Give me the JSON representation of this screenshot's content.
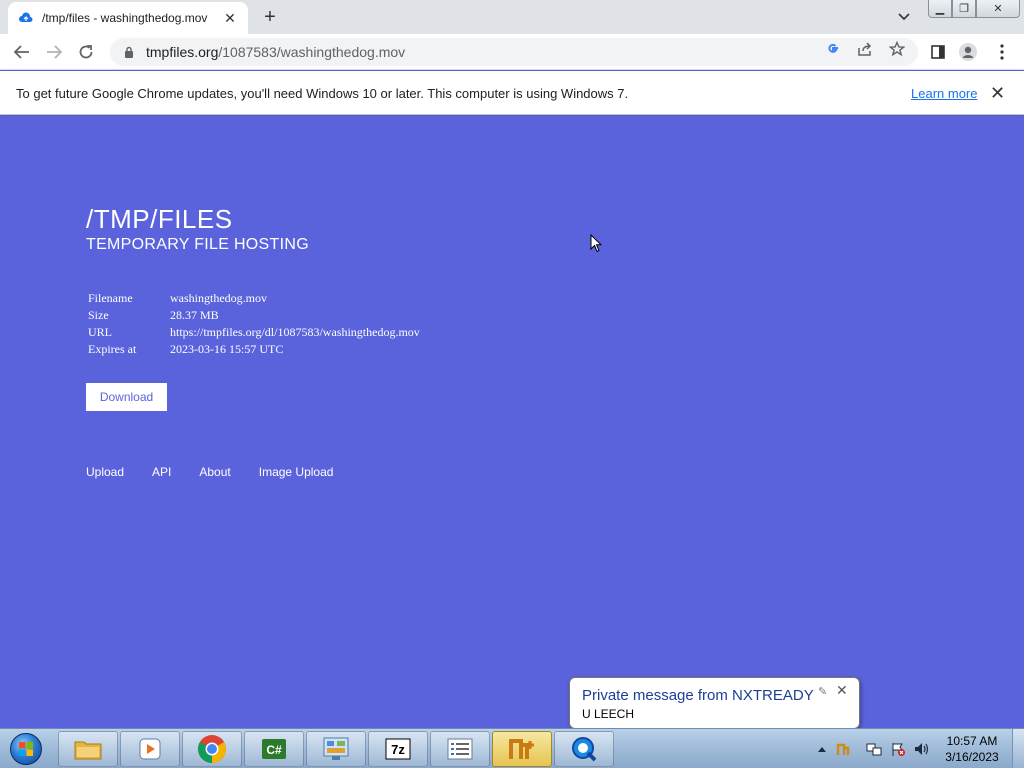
{
  "browser": {
    "tab_title": "/tmp/files - washingthedog.mov",
    "url_domain": "tmpfiles.org",
    "url_path": "/1087583/washingthedog.mov",
    "infobar_message": "To get future Google Chrome updates, you'll need Windows 10 or later. This computer is using Windows 7.",
    "infobar_link": "Learn more"
  },
  "page": {
    "title": "/TMP/FILES",
    "subtitle": "TEMPORARY FILE HOSTING",
    "file_info": [
      {
        "key": "Filename",
        "value": "washingthedog.mov"
      },
      {
        "key": "Size",
        "value": "28.37 MB"
      },
      {
        "key": "URL",
        "value": "https://tmpfiles.org/dl/1087583/washingthedog.mov"
      },
      {
        "key": "Expires at",
        "value": "2023-03-16 15:57 UTC"
      }
    ],
    "download_label": "Download",
    "footer_links": [
      "Upload",
      "API",
      "About",
      "Image Upload"
    ],
    "background_color": "#5b63dc"
  },
  "notification": {
    "title": "Private message from NXTREADY",
    "body": "U LEECH"
  },
  "taskbar": {
    "apps": [
      "explorer-icon",
      "media-player-icon",
      "chrome-icon",
      "csharp-app-icon",
      "control-panel-icon",
      "7zip-icon",
      "notepad-list-icon",
      "nx-app-icon",
      "quicktime-icon"
    ],
    "clock_time": "10:57 AM",
    "clock_date": "3/16/2023"
  }
}
